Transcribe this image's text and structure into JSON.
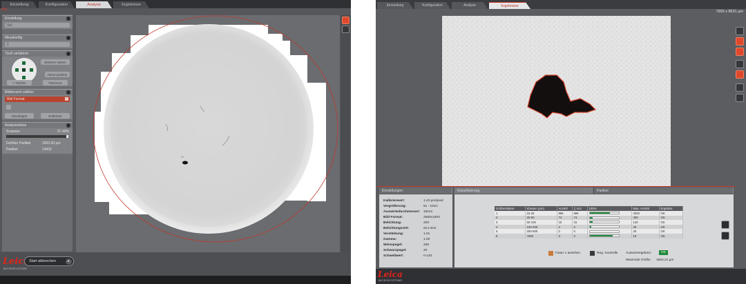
{
  "left": {
    "tabs": [
      "Einstellung",
      "Konfiguration",
      "Analyse",
      "Ergebnisse"
    ],
    "active_tab": 2,
    "red_header": "Bild",
    "sidebar": {
      "panel1": {
        "title": "Einstellung",
        "field": "Set"
      },
      "panel2": {
        "title": "Messkonfig",
        "field": "1"
      },
      "panel3": {
        "title": "Tisch verfahren",
        "btn_center": "Zentrum setzen",
        "btn_home": "Home position",
        "btn_left": "< Tisch/In",
        "btn_right": "Tisch/Aus"
      },
      "panel4": {
        "title": "Bildbereich wählen",
        "selected": "Bild Format",
        "btn_a": "Hinzufügen",
        "btn_b": "Entfernen"
      },
      "panel5": {
        "title": "Analysestatus",
        "status_label": "Scannen",
        "status_pct": "97.49%",
        "progress": 0.97,
        "largest_label": "Größter Partikel",
        "largest_value": "1650.00 µm",
        "count_label": "Partikel",
        "count_value": "14432"
      }
    },
    "start_button": "Start abbrechen",
    "start_arrow": "▸",
    "logo": "Leica",
    "logo_sub": "MICROSYSTEMS"
  },
  "right": {
    "tabs": [
      "Einstellung",
      "Konfiguration",
      "Analyse",
      "Ergebnisse"
    ],
    "active_tab": 3,
    "dimensions": "7655 x 8531 µm",
    "lower_tabs": [
      "Einstellungen",
      "Klassifizierung",
      "Partikel"
    ],
    "info": [
      {
        "label": "Kalibrierwert:",
        "value": "1.43 µm/pixel"
      },
      {
        "label": "Vergrößerung:",
        "value": "5x   - 10x/x"
      },
      {
        "label": "Auswertedurchmesser:",
        "value": "33mm"
      },
      {
        "label": "Bild Format:",
        "value": "2560x1920"
      },
      {
        "label": "Belichtung:",
        "value": "200"
      },
      {
        "label": "Belichtungszeit:",
        "value": "914.4ms"
      },
      {
        "label": "Verstärkung:",
        "value": "1.01"
      },
      {
        "label": "Gamma:",
        "value": "1.00"
      },
      {
        "label": "Weisspegel:",
        "value": "255"
      },
      {
        "label": "Schwarzpegel:",
        "value": "20"
      },
      {
        "label": "Schwellwert:",
        "value": "0-130"
      }
    ],
    "class_table": {
      "headers": [
        "Größenklasse",
        "Klassen (µm)",
        "Anzahl",
        "∑ Anz.",
        "100%",
        "Max. Anzahl",
        "Ergebnis"
      ],
      "rows": [
        {
          "k": "1",
          "range": "15-25",
          "n": "896",
          "sum": "896",
          "pct": 0.7,
          "max": "4000",
          "res": "OK"
        },
        {
          "k": "2",
          "range": "25-50",
          "n": "74",
          "sum": "74",
          "pct": 0.1,
          "max": "400",
          "res": "OK"
        },
        {
          "k": "3",
          "range": "50-100",
          "n": "15",
          "sum": "15",
          "pct": 0.1,
          "max": "130",
          "res": "OK"
        },
        {
          "k": "4",
          "range": "100-200",
          "n": "2",
          "sum": "2",
          "pct": 0.06,
          "max": "40",
          "res": "OK"
        },
        {
          "k": "5",
          "range": "200-500",
          "n": "0",
          "sum": "0",
          "pct": 0.0,
          "max": "20",
          "res": "OK"
        },
        {
          "k": "6",
          "range": ">500",
          "n": "3",
          "sum": "3",
          "pct": 0.8,
          "max": "10",
          "res": "OK"
        }
      ]
    },
    "checkbox1": "Faser 1 ansehen",
    "checkbox2": "Reg. Kontrolle",
    "result_label": "Auswertergebnis:",
    "result_value": "OK",
    "max_size_label": "Maximale Größe:",
    "max_size_value": "1553.21 µm",
    "logo": "Leica",
    "logo_sub": "MICROSYSTEMS"
  },
  "colors": {
    "accent_red": "#d23a2c",
    "leica_red": "#e2231a",
    "ok_green": "#1f8a3a"
  }
}
